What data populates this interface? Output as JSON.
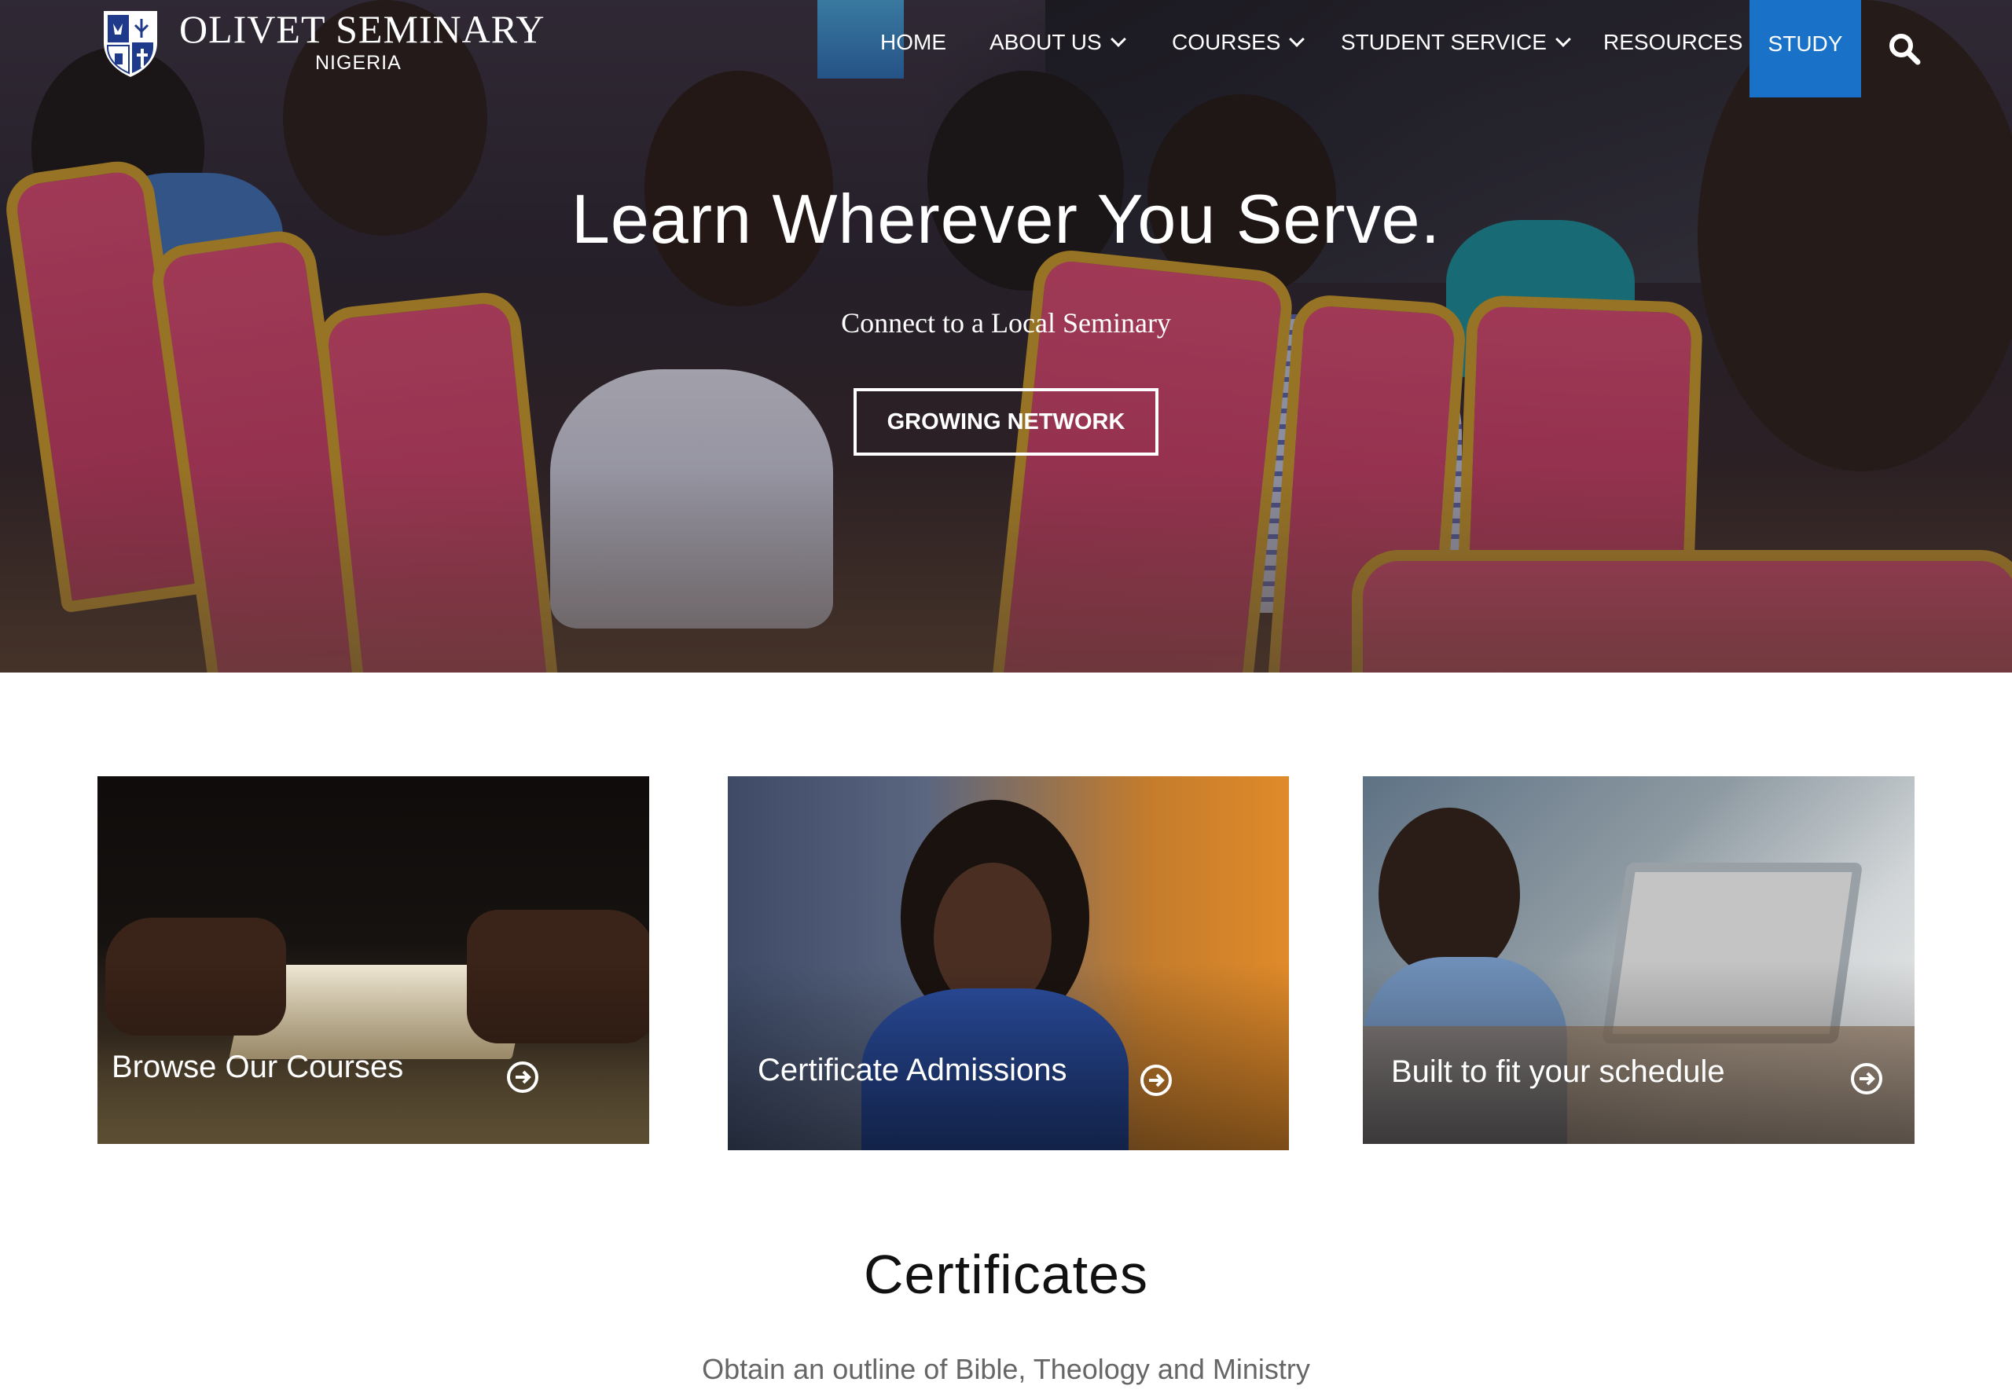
{
  "brand": {
    "title": "OLIVET SEMINARY",
    "subtitle": "NIGERIA",
    "logo_icon": "shield-crest-icon"
  },
  "nav": {
    "items": [
      {
        "label": "HOME",
        "has_dropdown": false
      },
      {
        "label": "ABOUT US",
        "has_dropdown": true
      },
      {
        "label": "COURSES",
        "has_dropdown": true
      },
      {
        "label": "STUDENT SERVICE",
        "has_dropdown": true
      },
      {
        "label": "RESOURCES",
        "has_dropdown": false
      }
    ],
    "cta_label": "STUDY",
    "cta_color": "#1972c8",
    "search_icon": "search-icon"
  },
  "hero": {
    "title": "Learn Wherever You Serve.",
    "subtitle": "Connect to a Local Seminary",
    "button_label": "GROWING NETWORK"
  },
  "cards": [
    {
      "label": "Browse Our Courses",
      "icon": "arrow-circle-right-icon"
    },
    {
      "label": "Certificate Admissions",
      "icon": "arrow-circle-right-icon"
    },
    {
      "label": "Built to fit your schedule",
      "icon": "arrow-circle-right-icon"
    }
  ],
  "certificates": {
    "title": "Certificates",
    "subtitle": "Obtain an outline of Bible, Theology and Ministry"
  }
}
